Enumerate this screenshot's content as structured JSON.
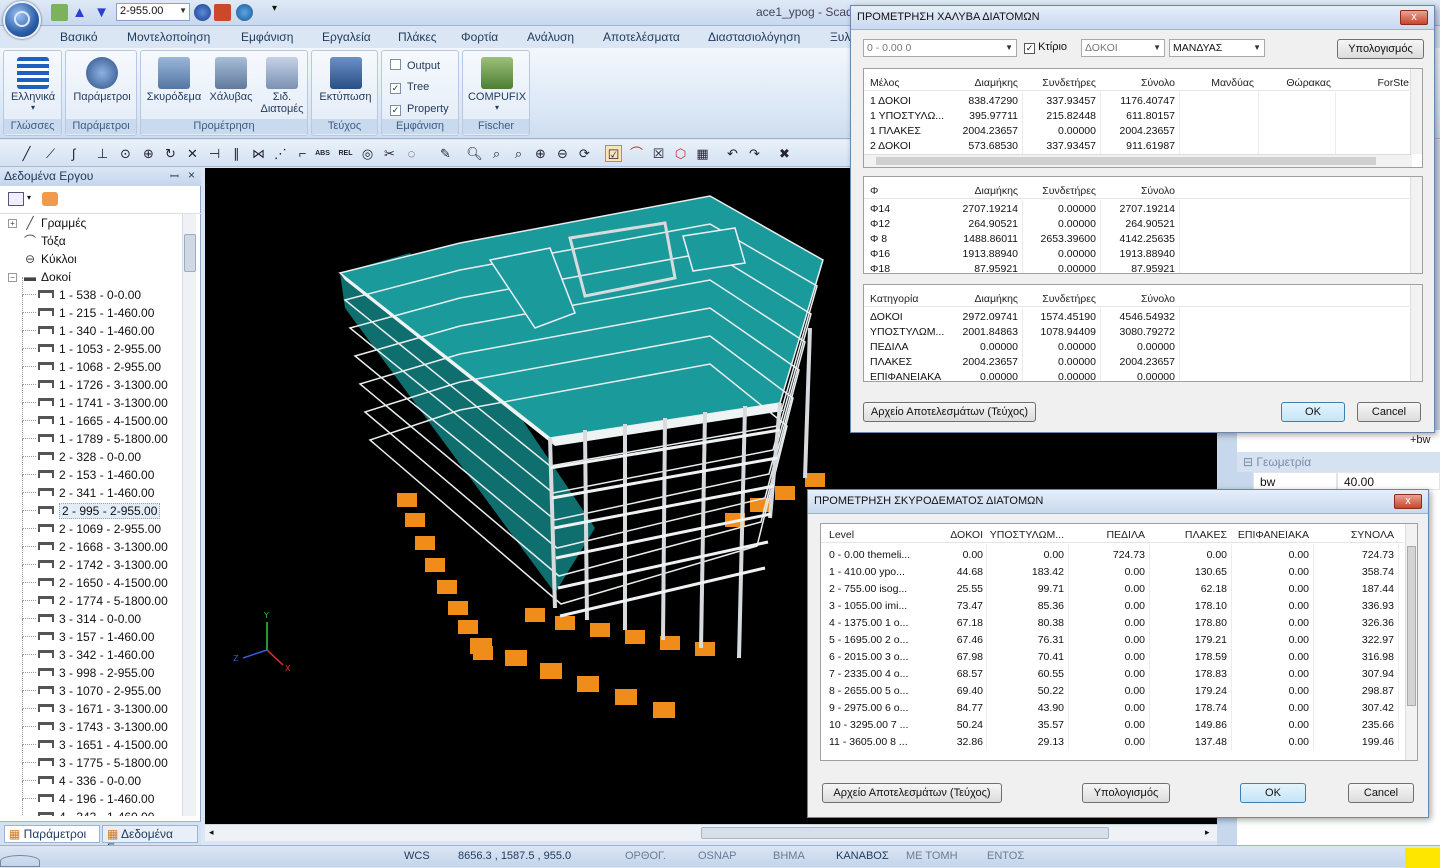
{
  "window": {
    "title": "ace1_ypog - Scad"
  },
  "quick_access": {
    "combo_value": "2-955.00"
  },
  "ribbon": {
    "tabs": [
      "Βασικό",
      "Μοντελοποίηση",
      "Εμφάνιση",
      "Εργαλεία",
      "Πλάκες",
      "Φορτία",
      "Ανάλυση",
      "Αποτελέσματα",
      "Διαστασιολόγηση",
      "Ξυλ"
    ],
    "groups": {
      "glosses": {
        "label": "Γλώσσες",
        "button": "Ελληνικά"
      },
      "parameters": {
        "label": "Παράμετροι",
        "button": "Παράμετροι"
      },
      "prometrisi": {
        "label": "Προμέτρηση",
        "buttons": [
          "Σκυρόδεμα",
          "Χάλυβας",
          "Σιδ. Διατομές"
        ]
      },
      "teuxos": {
        "label": "Τεύχος",
        "button": "Εκτύπωση"
      },
      "emfanisi": {
        "label": "Εμφάνιση",
        "checks": [
          {
            "label": "Output",
            "checked": false
          },
          {
            "label": "Tree",
            "checked": true
          },
          {
            "label": "Property",
            "checked": true
          }
        ]
      },
      "fischer": {
        "label": "Fischer",
        "button": "COMPUFIX"
      }
    }
  },
  "left_panel": {
    "title": "Δεδομένα Εργου",
    "tree": [
      {
        "label": "Γραμμές",
        "level": 0
      },
      {
        "label": "Τόξα",
        "level": 0
      },
      {
        "label": "Κύκλοι",
        "level": 0
      },
      {
        "label": "Δοκοί",
        "level": 0
      },
      {
        "label": "1 - 538 - 0-0.00",
        "level": 1
      },
      {
        "label": "1 - 215 - 1-460.00",
        "level": 1
      },
      {
        "label": "1 - 340 - 1-460.00",
        "level": 1
      },
      {
        "label": "1 - 1053 - 2-955.00",
        "level": 1
      },
      {
        "label": "1 - 1068 - 2-955.00",
        "level": 1
      },
      {
        "label": "1 - 1726 - 3-1300.00",
        "level": 1
      },
      {
        "label": "1 - 1741 - 3-1300.00",
        "level": 1
      },
      {
        "label": "1 - 1665 - 4-1500.00",
        "level": 1
      },
      {
        "label": "1 - 1789 - 5-1800.00",
        "level": 1
      },
      {
        "label": "2 - 328 - 0-0.00",
        "level": 1
      },
      {
        "label": "2 - 153 - 1-460.00",
        "level": 1
      },
      {
        "label": "2 - 341 - 1-460.00",
        "level": 1
      },
      {
        "label": "2 - 995 - 2-955.00",
        "level": 1
      },
      {
        "label": "2 - 1069 - 2-955.00",
        "level": 1
      },
      {
        "label": "2 - 1668 - 3-1300.00",
        "level": 1
      },
      {
        "label": "2 - 1742 - 3-1300.00",
        "level": 1
      },
      {
        "label": "2 - 1650 - 4-1500.00",
        "level": 1
      },
      {
        "label": "2 - 1774 - 5-1800.00",
        "level": 1
      },
      {
        "label": "3 - 314 - 0-0.00",
        "level": 1
      },
      {
        "label": "3 - 157 - 1-460.00",
        "level": 1
      },
      {
        "label": "3 - 342 - 1-460.00",
        "level": 1
      },
      {
        "label": "3 - 998 - 2-955.00",
        "level": 1
      },
      {
        "label": "3 - 1070 - 2-955.00",
        "level": 1
      },
      {
        "label": "3 - 1671 - 3-1300.00",
        "level": 1
      },
      {
        "label": "3 - 1743 - 3-1300.00",
        "level": 1
      },
      {
        "label": "3 - 1651 - 4-1500.00",
        "level": 1
      },
      {
        "label": "3 - 1775 - 5-1800.00",
        "level": 1
      },
      {
        "label": "4 - 336 - 0-0.00",
        "level": 1
      },
      {
        "label": "4 - 196 - 1-460.00",
        "level": 1
      },
      {
        "label": "4 - 343 - 1-460.00",
        "level": 1
      }
    ],
    "tabs": [
      "Παράμετροι ...",
      "Δεδομένα Ε..."
    ]
  },
  "right_strip": {
    "section": "Γεωμετρία",
    "prop_name": "bw",
    "prop_value": "40.00",
    "bw_tag": "+bw"
  },
  "status": {
    "wcs": "WCS",
    "coords": "8656.3 , 1587.5 , 955.0",
    "ortho": "ΟΡΘΟΓ.",
    "osnap": "OSNAP",
    "step": "ΒΗΜΑ",
    "grid": "ΚΑΝΑΒΟΣ",
    "section": "ΜΕ ΤΟΜΗ",
    "entos": "ΕΝΤΟΣ"
  },
  "steel_dialog": {
    "title": "ΠΡΟΜΕΤΡΗΣΗ ΧΑΛΥΒΑ ΔΙΑΤΟΜΩΝ",
    "close": "x",
    "combo_level": "0 - 0.00 0",
    "check_building": "Κτίριο",
    "combo_type": "ΔΟΚΟΙ",
    "combo_kind": "ΜΑΝΔΥΑΣ",
    "calc_btn": "Υπολογισμός",
    "members_headers": [
      "Μέλος",
      "Διαμήκης",
      "Συνδετήρες",
      "Σύνολο",
      "Μανδύας",
      "Θώρακας",
      "ForSte"
    ],
    "members_rows": [
      [
        "1 ΔΟΚΟΙ",
        "838.47290",
        "337.93457",
        "1176.40747"
      ],
      [
        "1 ΥΠΟΣΤΥΛΩ...",
        "395.97711",
        "215.82448",
        "611.80157"
      ],
      [
        "1 ΠΛΑΚΕΣ",
        "2004.23657",
        "0.00000",
        "2004.23657"
      ],
      [
        "2 ΔΟΚΟΙ",
        "573.68530",
        "337.93457",
        "911.61987"
      ]
    ],
    "diam_headers": [
      "Φ",
      "Διαμήκης",
      "Συνδετήρες",
      "Σύνολο"
    ],
    "diam_rows": [
      [
        "Φ14",
        "2707.19214",
        "0.00000",
        "2707.19214"
      ],
      [
        "Φ12",
        "264.90521",
        "0.00000",
        "264.90521"
      ],
      [
        "Φ 8",
        "1488.86011",
        "2653.39600",
        "4142.25635"
      ],
      [
        "Φ16",
        "1913.88940",
        "0.00000",
        "1913.88940"
      ],
      [
        "Φ18",
        "87.95921",
        "0.00000",
        "87.95921"
      ]
    ],
    "cat_headers": [
      "Κατηγορία",
      "Διαμήκης",
      "Συνδετήρες",
      "Σύνολο"
    ],
    "cat_rows": [
      [
        "ΔΟΚΟΙ",
        "2972.09741",
        "1574.45190",
        "4546.54932"
      ],
      [
        "ΥΠΟΣΤΥΛΩΜ...",
        "2001.84863",
        "1078.94409",
        "3080.79272"
      ],
      [
        "ΠΕΔΙΛΑ",
        "0.00000",
        "0.00000",
        "0.00000"
      ],
      [
        "ΠΛΑΚΕΣ",
        "2004.23657",
        "0.00000",
        "2004.23657"
      ],
      [
        "ΕΠΙΦΑΝΕΙΑΚΑ",
        "0.00000",
        "0.00000",
        "0.00000"
      ]
    ],
    "results_btn": "Αρχείο Αποτελεσμάτων (Τεύχος)",
    "ok": "OK",
    "cancel": "Cancel"
  },
  "concrete_dialog": {
    "title": "ΠΡΟΜΕΤΡΗΣΗ ΣΚΥΡΟΔΕΜΑΤΟΣ ΔΙΑΤΟΜΩΝ",
    "close": "x",
    "headers": [
      "Level",
      "ΔΟΚΟΙ",
      "ΥΠΟΣΤΥΛΩΜ...",
      "ΠΕΔΙΛΑ",
      "ΠΛΑΚΕΣ",
      "ΕΠΙΦΑΝΕΙΑΚΑ",
      "ΣΥΝΟΛΑ"
    ],
    "rows": [
      [
        "0 - 0.00 themeli...",
        "0.00",
        "0.00",
        "724.73",
        "0.00",
        "0.00",
        "724.73"
      ],
      [
        "1 - 410.00 ypo...",
        "44.68",
        "183.42",
        "0.00",
        "130.65",
        "0.00",
        "358.74"
      ],
      [
        "2 - 755.00 isog...",
        "25.55",
        "99.71",
        "0.00",
        "62.18",
        "0.00",
        "187.44"
      ],
      [
        "3 - 1055.00 imi...",
        "73.47",
        "85.36",
        "0.00",
        "178.10",
        "0.00",
        "336.93"
      ],
      [
        "4 - 1375.00 1 o...",
        "67.18",
        "80.38",
        "0.00",
        "178.80",
        "0.00",
        "326.36"
      ],
      [
        "5 - 1695.00 2 o...",
        "67.46",
        "76.31",
        "0.00",
        "179.21",
        "0.00",
        "322.97"
      ],
      [
        "6 - 2015.00 3 o...",
        "67.98",
        "70.41",
        "0.00",
        "178.59",
        "0.00",
        "316.98"
      ],
      [
        "7 - 2335.00 4 o...",
        "68.57",
        "60.55",
        "0.00",
        "178.83",
        "0.00",
        "307.94"
      ],
      [
        "8 - 2655.00 5 o...",
        "69.40",
        "50.22",
        "0.00",
        "179.24",
        "0.00",
        "298.87"
      ],
      [
        "9 - 2975.00 6 o...",
        "84.77",
        "43.90",
        "0.00",
        "178.74",
        "0.00",
        "307.42"
      ],
      [
        "10 - 3295.00 7 ...",
        "50.24",
        "35.57",
        "0.00",
        "149.86",
        "0.00",
        "235.66"
      ],
      [
        "11 - 3605.00 8 ...",
        "32.86",
        "29.13",
        "0.00",
        "137.48",
        "0.00",
        "199.46"
      ]
    ],
    "results_btn": "Αρχείο Αποτελεσμάτων (Τεύχος)",
    "calc_btn": "Υπολογισμός",
    "ok": "OK",
    "cancel": "Cancel"
  },
  "colors": {
    "slab": "#1a9a9a",
    "slab_side": "#0e6b6b",
    "column": "#cfd3d6",
    "footing": "#f08c1a",
    "viewport_bg": "#000000"
  }
}
